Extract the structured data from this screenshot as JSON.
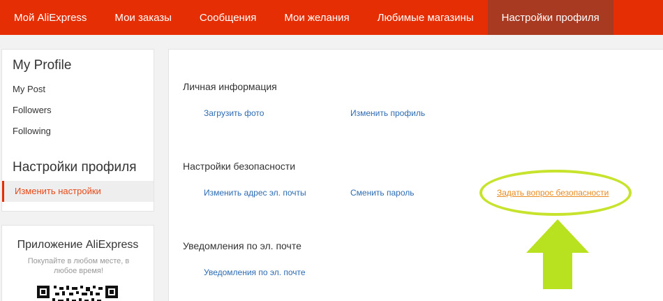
{
  "topnav": {
    "items": [
      {
        "label": "Мой AliExpress"
      },
      {
        "label": "Мои заказы"
      },
      {
        "label": "Сообщения"
      },
      {
        "label": "Мои желания"
      },
      {
        "label": "Любимые магазины"
      },
      {
        "label": "Настройки профиля",
        "active": true
      }
    ]
  },
  "sidebar": {
    "profile_heading": "My Profile",
    "links": [
      "My Post",
      "Followers",
      "Following"
    ],
    "settings_heading": "Настройки профиля",
    "active_link": "Изменить настройки"
  },
  "app": {
    "title": "Приложение AliExpress",
    "subtitle": "Покупайте в любом месте, в любое время!"
  },
  "main": {
    "personal": {
      "title": "Личная информация",
      "links": [
        "Загрузить фото",
        "Изменить профиль"
      ]
    },
    "security": {
      "title": "Настройки безопасности",
      "links": [
        "Изменить адрес эл. почты",
        "Сменить пароль",
        "Задать вопрос безопасности"
      ]
    },
    "email": {
      "title": "Уведомления по эл. почте",
      "links": [
        "Уведомления по эл. почте"
      ]
    }
  },
  "colors": {
    "nav_bg": "#e62e04",
    "nav_active": "#a83a22",
    "link": "#2d6bb3",
    "highlight": "#c7e32b",
    "orange_link": "#e88a1f"
  }
}
